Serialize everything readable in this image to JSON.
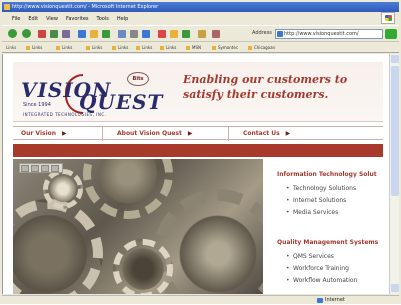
{
  "window": {
    "title": "http://www.visionquestit.com/ - Microsoft Internet Explorer"
  },
  "menu": [
    "File",
    "Edit",
    "View",
    "Favorites",
    "Tools",
    "Help"
  ],
  "toolbar": {
    "address_label": "Address",
    "address_value": "http://www.visionquestit.com/"
  },
  "links_bar": {
    "label": "Links",
    "items": [
      "Links",
      "Links",
      "Links",
      "Links",
      "Links",
      "Links",
      "MSN",
      "Symantec",
      "Chicagoan"
    ]
  },
  "status": {
    "zone": "Internet"
  },
  "site": {
    "logo": {
      "word1": "VISION",
      "word2": "QUEST",
      "since": "Since 1994",
      "subtitle": "INTEGRATED TECHNOLOGIES, INC.",
      "badge": "Bits"
    },
    "tagline": "Enabling our customers to satisfy their customers.",
    "nav": [
      {
        "label": "Our Vision"
      },
      {
        "label": "About Vision Quest"
      },
      {
        "label": "Contact Us"
      }
    ],
    "nav_arrow": "▶",
    "sections": [
      {
        "title": "Information Technology Solut",
        "items": [
          "Technology Solutions",
          "Internet Solutions",
          "Media Services"
        ]
      },
      {
        "title": "Quality Management Systems",
        "items": [
          "QMS Services",
          "Workforce Training",
          "Workflow Automation"
        ]
      }
    ]
  },
  "colors": {
    "brand_red": "#a83a2c",
    "brand_navy": "#2a2c6a",
    "link_red": "#a33a30"
  }
}
